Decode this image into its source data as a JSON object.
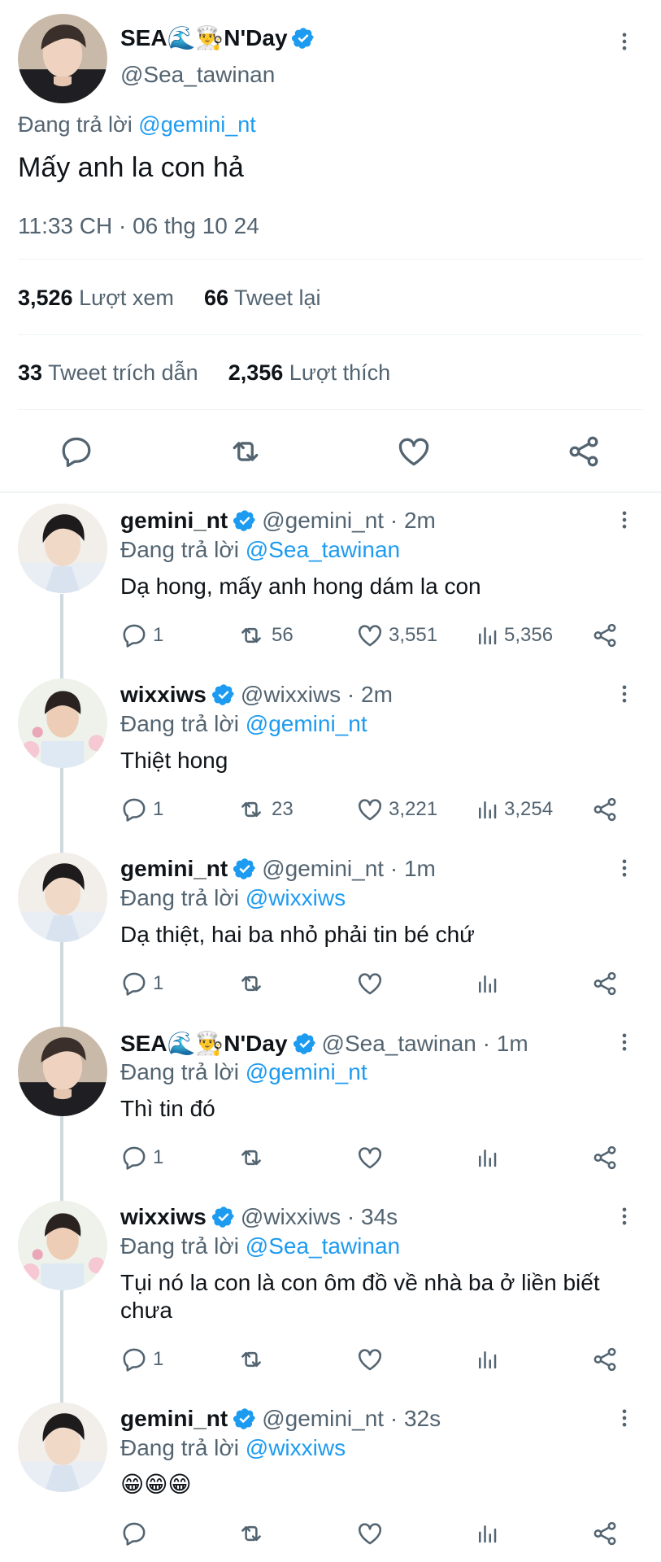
{
  "main_tweet": {
    "display_name": "SEA🌊👨‍🍳N'Day",
    "handle": "@Sea_tawinan",
    "replying_prefix": "Đang trả lời",
    "replying_to": "@gemini_nt",
    "text": "Mấy anh la con hả",
    "timestamp": "11:33 CH · 06 thg 10 24",
    "views_count": "3,526",
    "views_label": "Lượt xem",
    "retweets_count": "66",
    "retweets_label": "Tweet lại",
    "quotes_count": "33",
    "quotes_label": "Tweet trích dẫn",
    "likes_count": "2,356",
    "likes_label": "Lượt thích"
  },
  "replies": [
    {
      "name": "gemini_nt",
      "handle": "@gemini_nt · 2m",
      "replying_prefix": "Đang trả lời",
      "replying_to": "@Sea_tawinan",
      "text": "Dạ hong, mấy anh hong dám la con",
      "replies": "1",
      "retweets": "56",
      "likes": "3,551",
      "views": "5,356"
    },
    {
      "name": "wixxiws",
      "handle": "@wixxiws · 2m",
      "replying_prefix": "Đang trả lời",
      "replying_to": "@gemini_nt",
      "text": "Thiệt hong",
      "replies": "1",
      "retweets": "23",
      "likes": "3,221",
      "views": "3,254"
    },
    {
      "name": "gemini_nt",
      "handle": "@gemini_nt · 1m",
      "replying_prefix": "Đang trả lời",
      "replying_to": "@wixxiws",
      "text": "Dạ thiệt, hai ba nhỏ phải tin bé chứ",
      "replies": "1",
      "retweets": "",
      "likes": "",
      "views": ""
    },
    {
      "name": "SEA🌊👨‍🍳N'Day",
      "handle": "@Sea_tawinan · 1m",
      "replying_prefix": "Đang trả lời",
      "replying_to": "@gemini_nt",
      "text": "Thì tin đó",
      "replies": "1",
      "retweets": "",
      "likes": "",
      "views": ""
    },
    {
      "name": "wixxiws",
      "handle": "@wixxiws · 34s",
      "replying_prefix": "Đang trả lời",
      "replying_to": "@Sea_tawinan",
      "text": "Tụi nó la con là con ôm đồ về nhà ba ở liền biết chưa",
      "replies": "1",
      "retweets": "",
      "likes": "",
      "views": ""
    },
    {
      "name": "gemini_nt",
      "handle": "@gemini_nt · 32s",
      "replying_prefix": "Đang trả lời",
      "replying_to": "@wixxiws",
      "text": "😁😁😁",
      "replies": "",
      "retweets": "",
      "likes": "",
      "views": ""
    }
  ],
  "colors": {
    "accent": "#1d9bf0",
    "muted": "#536471",
    "text": "#0f1419",
    "divider": "#eff3f4",
    "thread_line": "#cfd9de"
  },
  "icons": {
    "verified": "verified-badge-icon",
    "more": "more-options-icon",
    "reply": "reply-icon",
    "retweet": "retweet-icon",
    "like": "like-icon",
    "share": "share-icon",
    "views": "views-icon"
  }
}
